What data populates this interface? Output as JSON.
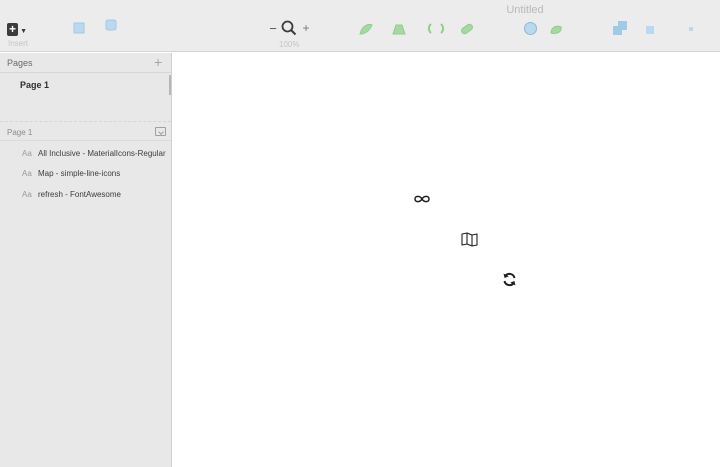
{
  "window": {
    "title": "Untitled"
  },
  "toolbar": {
    "insert_label": "Insert",
    "insert_icon": "plus-icon",
    "zoom_level": "100%",
    "zoom_minus": "−",
    "zoom_plus": "+",
    "tool_icons": [
      "rectangle-tool-icon",
      "oval-tool-icon",
      "vector-tool-icon",
      "pencil-tool-icon",
      "rotate-copies-icon",
      "flatten-icon",
      "mask-icon",
      "scale-icon",
      "union-icon",
      "subtract-icon",
      "forward-icon",
      "backward-icon"
    ]
  },
  "sidebar": {
    "pages_title": "Pages",
    "pages_add": "+",
    "pages": [
      {
        "label": "Page 1"
      }
    ],
    "layers_title": "Page 1",
    "layers": [
      {
        "icon": "Aa",
        "label": "All Inclusive - MaterialIcons-Regular"
      },
      {
        "icon": "Aa",
        "label": "Map - simple-line-icons"
      },
      {
        "icon": "Aa",
        "label": "refresh - FontAwesome"
      }
    ]
  },
  "canvas": {
    "items": [
      {
        "name": "all-inclusive-icon",
        "layer": "All Inclusive - MaterialIcons-Regular"
      },
      {
        "name": "map-icon",
        "layer": "Map - simple-line-icons"
      },
      {
        "name": "refresh-icon",
        "layer": "refresh - FontAwesome"
      }
    ]
  },
  "colors": {
    "toolbar_bg": "#ececec",
    "sidebar_bg": "#e8e8e8",
    "canvas_bg": "#ffffff",
    "tool_icon_green": "#8ccf86",
    "tool_icon_blue": "#9ecbe8"
  }
}
